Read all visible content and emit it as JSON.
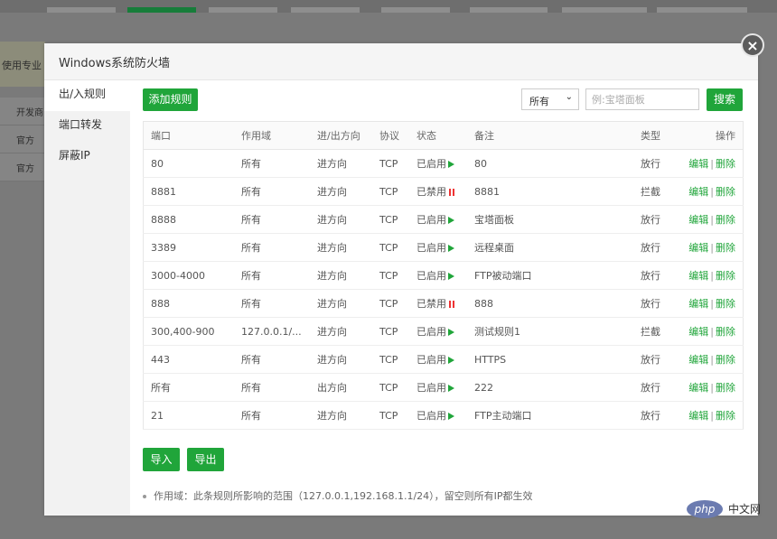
{
  "background": {
    "strip_text": "使用专业",
    "rows": [
      "开发商",
      "官方",
      "官方"
    ]
  },
  "modal": {
    "title": "Windows系统防火墙",
    "close_label": "×"
  },
  "sidebar": {
    "items": [
      {
        "label": "出/入规则"
      },
      {
        "label": "端口转发"
      },
      {
        "label": "屏蔽IP"
      }
    ]
  },
  "toolbar": {
    "add_label": "添加规则",
    "filter_value": "所有",
    "search_placeholder": "例:宝塔面板",
    "search_label": "搜索"
  },
  "table": {
    "headers": {
      "port": "端口",
      "scope": "作用域",
      "direction": "进/出方向",
      "protocol": "协议",
      "status": "状态",
      "remark": "备注",
      "type": "类型",
      "action": "操作"
    },
    "edit_label": "编辑",
    "delete_label": "删除",
    "rows": [
      {
        "port": "80",
        "scope": "所有",
        "direction": "进方向",
        "protocol": "TCP",
        "status": "已启用",
        "enabled": true,
        "remark": "80",
        "type": "放行",
        "allow": true
      },
      {
        "port": "8881",
        "scope": "所有",
        "direction": "进方向",
        "protocol": "TCP",
        "status": "已禁用",
        "enabled": false,
        "remark": "8881",
        "type": "拦截",
        "allow": false
      },
      {
        "port": "8888",
        "scope": "所有",
        "direction": "进方向",
        "protocol": "TCP",
        "status": "已启用",
        "enabled": true,
        "remark": "宝塔面板",
        "type": "放行",
        "allow": true
      },
      {
        "port": "3389",
        "scope": "所有",
        "direction": "进方向",
        "protocol": "TCP",
        "status": "已启用",
        "enabled": true,
        "remark": "远程桌面",
        "type": "放行",
        "allow": true
      },
      {
        "port": "3000-4000",
        "scope": "所有",
        "direction": "进方向",
        "protocol": "TCP",
        "status": "已启用",
        "enabled": true,
        "remark": "FTP被动端口",
        "type": "放行",
        "allow": true
      },
      {
        "port": "888",
        "scope": "所有",
        "direction": "进方向",
        "protocol": "TCP",
        "status": "已禁用",
        "enabled": false,
        "remark": "888",
        "type": "放行",
        "allow": true
      },
      {
        "port": "300,400-900",
        "scope": "127.0.0.1/...",
        "direction": "进方向",
        "protocol": "TCP",
        "status": "已启用",
        "enabled": true,
        "remark": "测试规则1",
        "type": "拦截",
        "allow": false
      },
      {
        "port": "443",
        "scope": "所有",
        "direction": "进方向",
        "protocol": "TCP",
        "status": "已启用",
        "enabled": true,
        "remark": "HTTPS",
        "type": "放行",
        "allow": true
      },
      {
        "port": "所有",
        "scope": "所有",
        "direction": "出方向",
        "protocol": "TCP",
        "status": "已启用",
        "enabled": true,
        "remark": "222",
        "type": "放行",
        "allow": true
      },
      {
        "port": "21",
        "scope": "所有",
        "direction": "进方向",
        "protocol": "TCP",
        "status": "已启用",
        "enabled": true,
        "remark": "FTP主动端口",
        "type": "放行",
        "allow": true
      }
    ]
  },
  "footer": {
    "import_label": "导入",
    "export_label": "导出",
    "note": "作用域：此条规则所影响的范围（127.0.0.1,192.168.1.1/24），留空则所有IP都生效"
  },
  "watermark": {
    "logo": "php",
    "text": "中文网"
  },
  "colors": {
    "accent": "#20a53a",
    "danger": "#ee3333"
  }
}
